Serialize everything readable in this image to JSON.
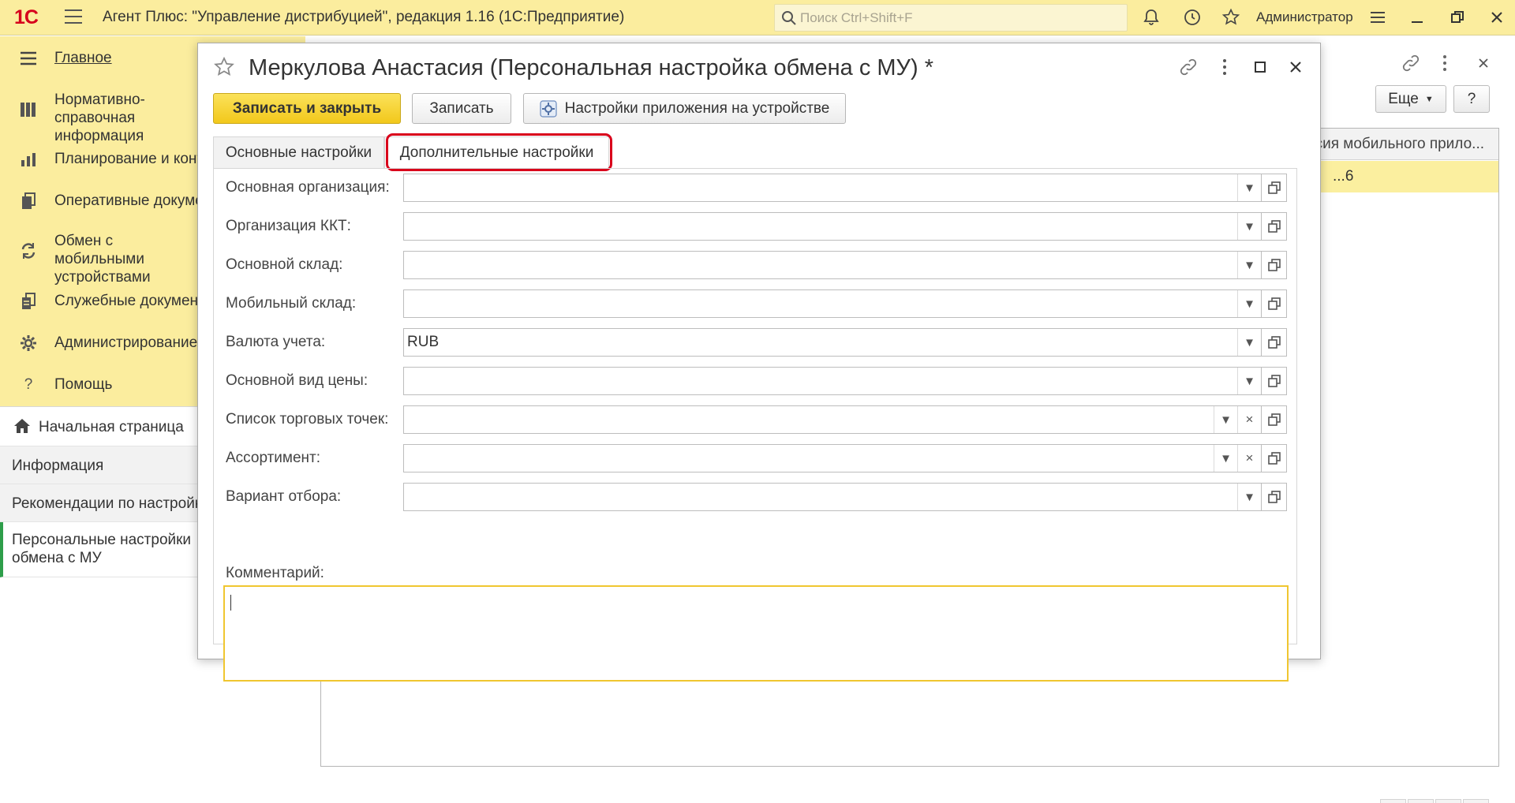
{
  "app": {
    "logo": "1С",
    "title": "Агент Плюс: \"Управление дистрибуцией\", редакция 1.16  (1С:Предприятие)",
    "search_placeholder": "Поиск Ctrl+Shift+F",
    "user": "Администратор"
  },
  "sidebar": {
    "items": [
      {
        "label": "Главное",
        "icon": "menu-lines-icon"
      },
      {
        "label": "Нормативно-справочная информация",
        "icon": "grid-book-icon"
      },
      {
        "label": "Планирование и контроль",
        "icon": "bar-chart-icon"
      },
      {
        "label": "Оперативные документы",
        "icon": "documents-icon"
      },
      {
        "label": "Обмен с мобильными устройствами",
        "icon": "sync-icon"
      },
      {
        "label": "Служебные документы",
        "icon": "service-docs-icon"
      },
      {
        "label": "Администрирование",
        "icon": "gear-icon"
      },
      {
        "label": "Помощь",
        "icon": "question-icon"
      }
    ]
  },
  "open_windows": [
    {
      "label": "Начальная страница",
      "icon": "home-icon"
    },
    {
      "label": "Информация"
    },
    {
      "label": "Рекомендации по настройке"
    },
    {
      "label": "Персональные настройки обмена с МУ"
    }
  ],
  "background_window": {
    "more_label": "Еще",
    "help_label": "?",
    "column_header": "Версия мобильного прило...",
    "row_value": "...6"
  },
  "dialog": {
    "title": "Меркулова Анастасия (Персональная настройка обмена с МУ) *",
    "buttons": {
      "save_close": "Записать и закрыть",
      "save": "Записать",
      "device_settings": "Настройки приложения на устройстве"
    },
    "tabs": [
      {
        "label": "Основные настройки",
        "active": false
      },
      {
        "label": "Дополнительные настройки",
        "active": true
      }
    ],
    "fields": [
      {
        "label": "Основная организация:",
        "value": "",
        "clear": false
      },
      {
        "label": "Организация ККТ:",
        "value": "",
        "clear": false
      },
      {
        "label": "Основной склад:",
        "value": "",
        "clear": false
      },
      {
        "label": "Мобильный склад:",
        "value": "",
        "clear": false
      },
      {
        "label": "Валюта учета:",
        "value": "RUB",
        "clear": false
      },
      {
        "label": "Основной вид цены:",
        "value": "",
        "clear": false
      },
      {
        "label": "Список торговых точек:",
        "value": "",
        "clear": true
      },
      {
        "label": "Ассортимент:",
        "value": "",
        "clear": true
      },
      {
        "label": "Вариант отбора:",
        "value": "",
        "clear": false
      }
    ],
    "comment_label": "Комментарий:",
    "comment_value": ""
  },
  "colors": {
    "panel_yellow": "#fbed9e",
    "primary_button": "#f2c81b",
    "tab_highlight": "#d9001b",
    "active_green": "#2e9e4a",
    "logo_red": "#d6001c"
  }
}
